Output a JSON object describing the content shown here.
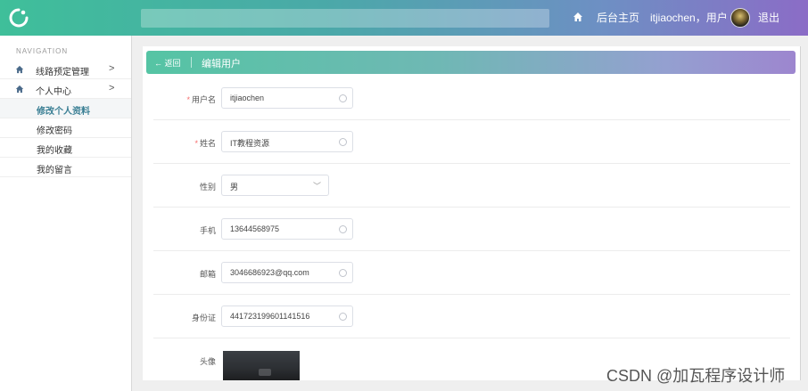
{
  "topbar": {
    "home_label": "后台主页",
    "user_label": "itjiaochen，用户",
    "logout_label": "退出"
  },
  "sidebar": {
    "nav_title": "NAVIGATION",
    "items": [
      {
        "label": "线路预定管理",
        "icon": "home-icon"
      },
      {
        "label": "个人中心",
        "icon": "home-icon"
      }
    ],
    "subitems": [
      {
        "label": "修改个人资料",
        "active": true
      },
      {
        "label": "修改密码"
      },
      {
        "label": "我的收藏"
      },
      {
        "label": "我的留言"
      }
    ]
  },
  "panel": {
    "back_label": "← 返回",
    "title": "编辑用户"
  },
  "form": {
    "username": {
      "label": "用户名",
      "value": "itjiaochen",
      "required": true
    },
    "name": {
      "label": "姓名",
      "value": "IT教程资源",
      "required": true
    },
    "gender": {
      "label": "性别",
      "value": "男"
    },
    "phone": {
      "label": "手机",
      "value": "13644568975"
    },
    "email": {
      "label": "邮箱",
      "value": "3046686923@qq.com"
    },
    "idcard": {
      "label": "身份证",
      "value": "441723199601141516"
    },
    "avatar": {
      "label": "头像"
    }
  },
  "watermark": "CSDN @加瓦程序设计师",
  "colors": {
    "accent_green": "#3fbf9a",
    "accent_purple": "#8b6cc6",
    "required": "#f56c6c",
    "active_nav": "#3a7f94"
  }
}
